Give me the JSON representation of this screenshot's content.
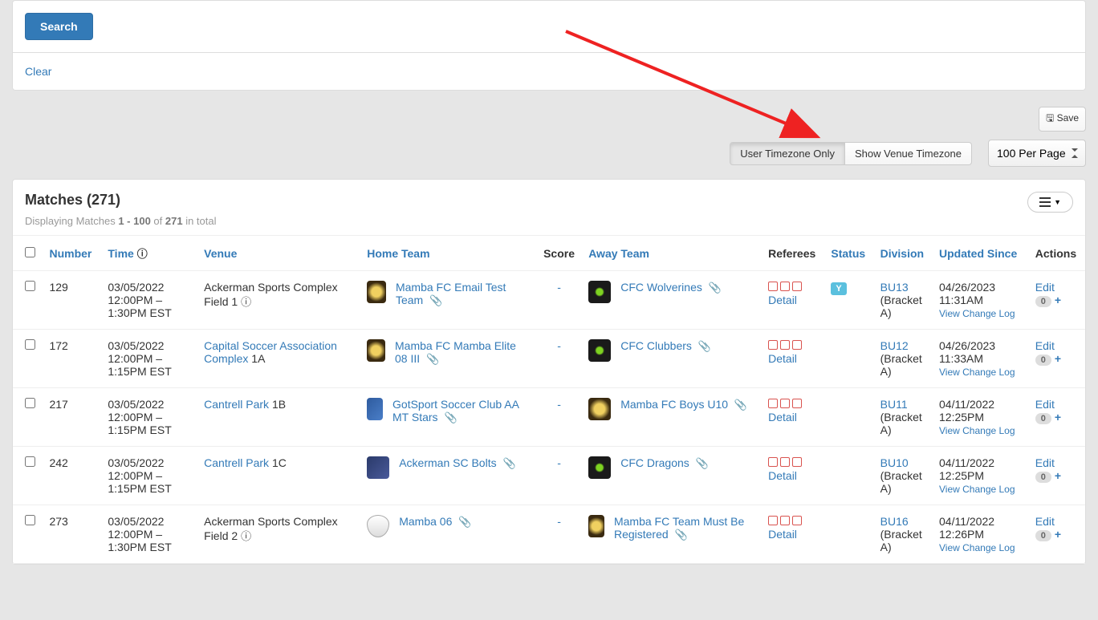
{
  "search": {
    "button": "Search",
    "clear": "Clear"
  },
  "toolbar": {
    "save": "Save",
    "tz_user": "User Timezone Only",
    "tz_venue": "Show Venue Timezone",
    "per_page": "100 Per Page"
  },
  "header": {
    "title": "Matches (271)",
    "subtitle_pre": "Displaying Matches ",
    "subtitle_range": "1 - 100",
    "subtitle_mid": " of ",
    "subtitle_total": "271",
    "subtitle_post": " in total"
  },
  "columns": {
    "number": "Number",
    "time": "Time",
    "venue": "Venue",
    "home_team": "Home Team",
    "score": "Score",
    "away_team": "Away Team",
    "referees": "Referees",
    "status": "Status",
    "division": "Division",
    "updated_since": "Updated Since",
    "actions": "Actions"
  },
  "labels": {
    "detail": "Detail",
    "edit": "Edit",
    "view_change_log": "View Change Log",
    "badge_y": "Y",
    "zero": "0"
  },
  "rows": [
    {
      "number": "129",
      "time": "03/05/2022 12:00PM – 1:30PM EST",
      "venue_text": "Ackerman Sports Complex Field 1",
      "venue_link": false,
      "venue_suffix": "",
      "venue_info": true,
      "home_logo": "logo-mamba",
      "home_team": "Mamba FC Email Test Team",
      "home_attach": true,
      "score": "-",
      "away_logo": "logo-cfc",
      "away_team": "CFC Wolverines",
      "away_attach": true,
      "status_badge": true,
      "division": "BU13",
      "bracket": "(Bracket A)",
      "updated": "04/26/2023 11:31AM"
    },
    {
      "number": "172",
      "time": "03/05/2022 12:00PM – 1:15PM EST",
      "venue_text": "Capital Soccer Association Complex",
      "venue_link": true,
      "venue_suffix": " 1A",
      "venue_info": false,
      "home_logo": "logo-mamba",
      "home_team": "Mamba FC Mamba Elite 08 III",
      "home_attach": true,
      "score": "-",
      "away_logo": "logo-cfc",
      "away_team": "CFC Clubbers",
      "away_attach": true,
      "status_badge": false,
      "division": "BU12",
      "bracket": "(Bracket A)",
      "updated": "04/26/2023 11:33AM"
    },
    {
      "number": "217",
      "time": "03/05/2022 12:00PM – 1:15PM EST",
      "venue_text": "Cantrell Park",
      "venue_link": true,
      "venue_suffix": " 1B",
      "venue_info": false,
      "home_logo": "logo-gotsport",
      "home_team": "GotSport Soccer Club AA MT Stars",
      "home_attach": true,
      "score": "-",
      "away_logo": "logo-mamba",
      "away_team": "Mamba FC Boys U10",
      "away_attach": true,
      "status_badge": false,
      "division": "BU11",
      "bracket": "(Bracket A)",
      "updated": "04/11/2022 12:25PM"
    },
    {
      "number": "242",
      "time": "03/05/2022 12:00PM – 1:15PM EST",
      "venue_text": "Cantrell Park",
      "venue_link": true,
      "venue_suffix": " 1C",
      "venue_info": false,
      "home_logo": "logo-bolts",
      "home_team": "Ackerman SC Bolts",
      "home_attach": true,
      "score": "-",
      "away_logo": "logo-cfc",
      "away_team": "CFC Dragons",
      "away_attach": true,
      "status_badge": false,
      "division": "BU10",
      "bracket": "(Bracket A)",
      "updated": "04/11/2022 12:25PM"
    },
    {
      "number": "273",
      "time": "03/05/2022 12:00PM – 1:30PM EST",
      "venue_text": "Ackerman Sports Complex Field 2",
      "venue_link": false,
      "venue_suffix": "",
      "venue_info": true,
      "home_logo": "logo-shield",
      "home_team": "Mamba 06",
      "home_attach": true,
      "score": "-",
      "away_logo": "logo-mamba",
      "away_team": "Mamba FC Team Must Be Registered",
      "away_attach": true,
      "status_badge": false,
      "division": "BU16",
      "bracket": "(Bracket A)",
      "updated": "04/11/2022 12:26PM"
    }
  ]
}
